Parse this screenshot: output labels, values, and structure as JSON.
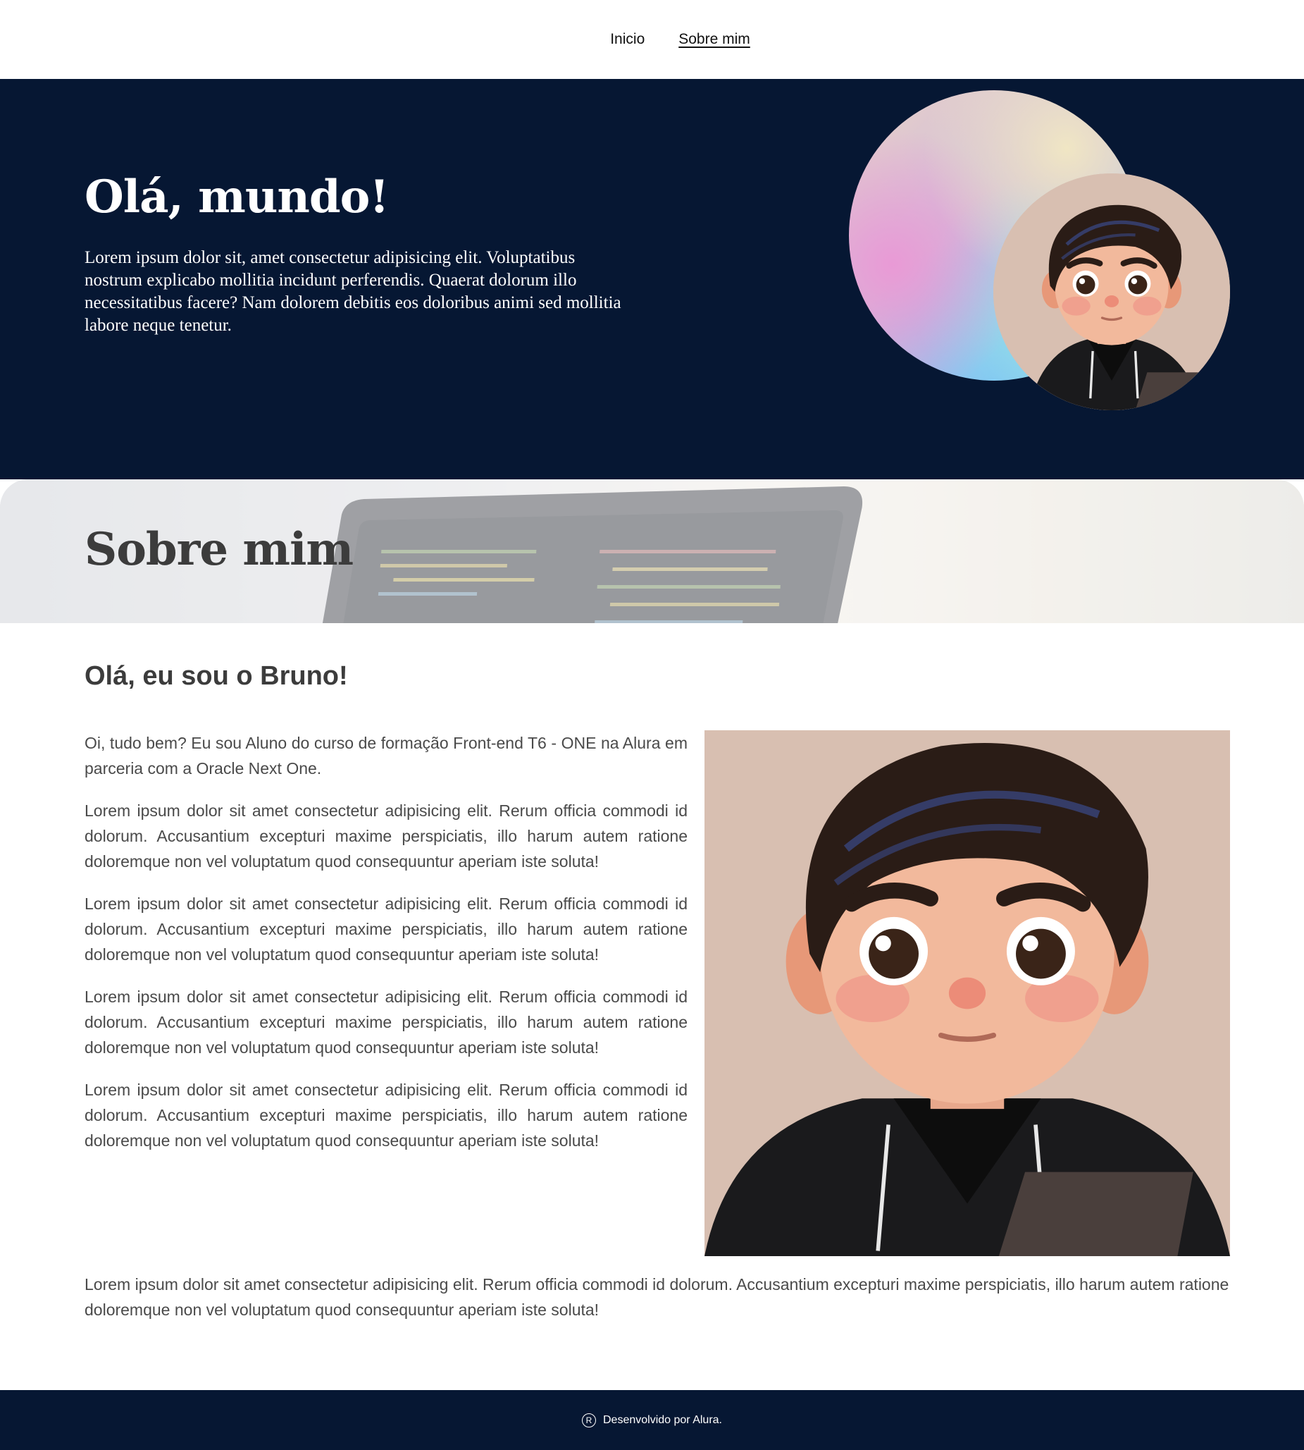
{
  "nav": {
    "items": [
      {
        "label": "Inicio",
        "active": false
      },
      {
        "label": "Sobre mim",
        "active": true
      }
    ]
  },
  "hero": {
    "title": "Olá, mundo!",
    "text": "Lorem ipsum dolor sit, amet consectetur adipisicing elit. Voluptatibus nostrum explicabo mollitia incidunt perferendis. Quaerat dolorum illo necessitatibus facere? Nam dolorem debitis eos doloribus animi sed mollitia labore neque tenetur."
  },
  "banner": {
    "title": "Sobre mim"
  },
  "about": {
    "title": "Olá, eu sou o Bruno!",
    "paragraphs": [
      "Oi, tudo bem? Eu sou Aluno do curso de formação Front-end T6 - ONE na Alura em parceria com a Oracle Next One.",
      "Lorem ipsum dolor sit amet consectetur adipisicing elit. Rerum officia commodi id dolorum. Accusantium excepturi maxime perspiciatis, illo harum autem ratione doloremque non vel voluptatum quod consequuntur aperiam iste soluta!",
      "Lorem ipsum dolor sit amet consectetur adipisicing elit. Rerum officia commodi id dolorum. Accusantium excepturi maxime perspiciatis, illo harum autem ratione doloremque non vel voluptatum quod consequuntur aperiam iste soluta!",
      "Lorem ipsum dolor sit amet consectetur adipisicing elit. Rerum officia commodi id dolorum. Accusantium excepturi maxime perspiciatis, illo harum autem ratione doloremque non vel voluptatum quod consequuntur aperiam iste soluta!",
      "Lorem ipsum dolor sit amet consectetur adipisicing elit. Rerum officia commodi id dolorum. Accusantium excepturi maxime perspiciatis, illo harum autem ratione doloremque non vel voluptatum quod consequuntur aperiam iste soluta!"
    ],
    "last_paragraph": "Lorem ipsum dolor sit amet consectetur adipisicing elit. Rerum officia commodi id dolorum. Accusantium excepturi maxime perspiciatis, illo harum autem ratione doloremque non vel voluptatum quod consequuntur aperiam iste soluta!"
  },
  "footer": {
    "icon": "registered-icon",
    "icon_glyph": "R",
    "text": "Desenvolvido por Alura."
  },
  "colors": {
    "navy": "#061733",
    "text_gray": "#4a4a4a",
    "heading_gray": "#3c3c3c",
    "avatar_bg": "#d8bfb1"
  }
}
